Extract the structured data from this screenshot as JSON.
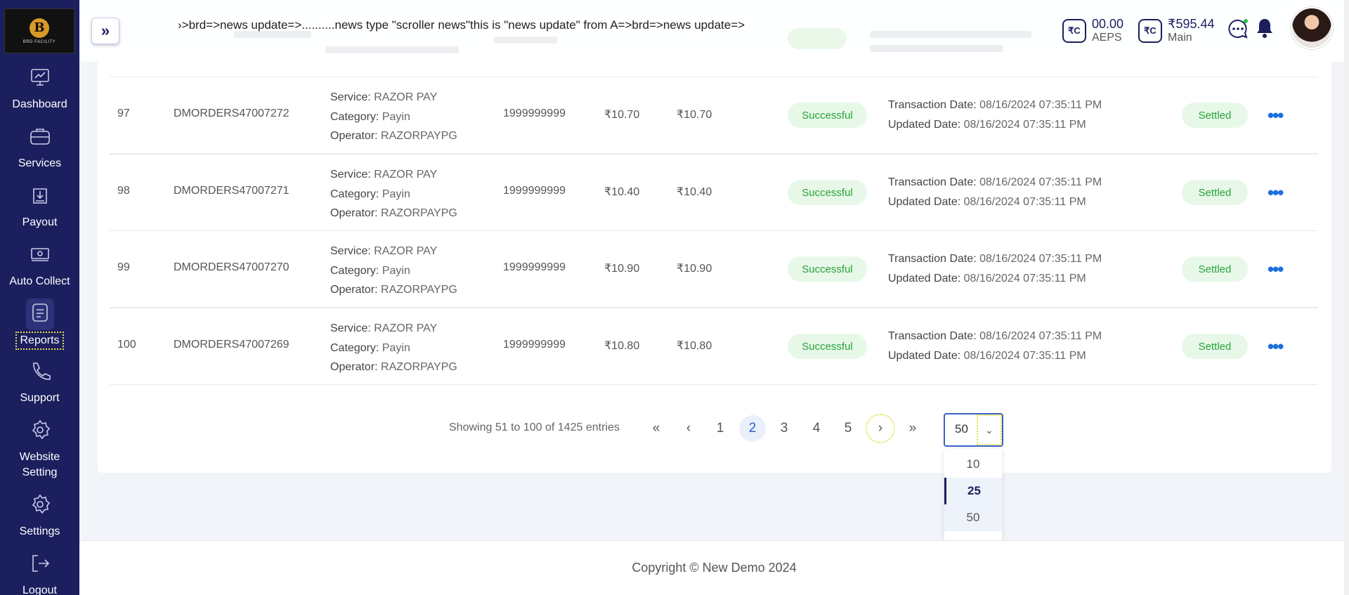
{
  "sidebar": {
    "logo_text": "BRD FACILITY",
    "items": [
      {
        "label": "Dashboard",
        "icon": "monitor-icon"
      },
      {
        "label": "Services",
        "icon": "briefcase-icon"
      },
      {
        "label": "Payout",
        "icon": "download-icon"
      },
      {
        "label": "Auto Collect",
        "icon": "cash-icon"
      },
      {
        "label": "Reports",
        "icon": "report-icon"
      },
      {
        "label": "Support",
        "icon": "phone-icon"
      },
      {
        "label": "Website Setting",
        "icon": "gear-icon"
      },
      {
        "label": "Settings",
        "icon": "gear-icon"
      },
      {
        "label": "Logout",
        "icon": "logout-icon"
      }
    ]
  },
  "header": {
    "toggle_glyph": "»",
    "news": "›>brd=>news update=>..........news type \"scroller news\"this is \"news update\" from A=>brd=>news update=>",
    "wallets": [
      {
        "amount": "00.00",
        "label": "AEPS",
        "icon_text": "₹C"
      },
      {
        "amount": "₹595.44",
        "label": "Main",
        "icon_text": "₹C"
      }
    ]
  },
  "rows": [
    {
      "num": "97",
      "order_id": "DMORDERS47007272",
      "service": "RAZOR PAY",
      "category": "Payin",
      "operator": "RAZORPAYPG",
      "mobile": "1999999999",
      "amount": "₹10.70",
      "net": "₹10.70",
      "status": "Successful",
      "txn_date": "08/16/2024 07:35:11 PM",
      "upd_date": "08/16/2024 07:35:11 PM",
      "settle": "Settled"
    },
    {
      "num": "98",
      "order_id": "DMORDERS47007271",
      "service": "RAZOR PAY",
      "category": "Payin",
      "operator": "RAZORPAYPG",
      "mobile": "1999999999",
      "amount": "₹10.40",
      "net": "₹10.40",
      "status": "Successful",
      "txn_date": "08/16/2024 07:35:11 PM",
      "upd_date": "08/16/2024 07:35:11 PM",
      "settle": "Settled"
    },
    {
      "num": "99",
      "order_id": "DMORDERS47007270",
      "service": "RAZOR PAY",
      "category": "Payin",
      "operator": "RAZORPAYPG",
      "mobile": "1999999999",
      "amount": "₹10.90",
      "net": "₹10.90",
      "status": "Successful",
      "txn_date": "08/16/2024 07:35:11 PM",
      "upd_date": "08/16/2024 07:35:11 PM",
      "settle": "Settled"
    },
    {
      "num": "100",
      "order_id": "DMORDERS47007269",
      "service": "RAZOR PAY",
      "category": "Payin",
      "operator": "RAZORPAYPG",
      "mobile": "1999999999",
      "amount": "₹10.80",
      "net": "₹10.80",
      "status": "Successful",
      "txn_date": "08/16/2024 07:35:11 PM",
      "upd_date": "08/16/2024 07:35:11 PM",
      "settle": "Settled"
    }
  ],
  "labels": {
    "service": "Service:",
    "category": "Category:",
    "operator": "Operator:",
    "txn_date": "Transaction Date:",
    "upd_date": "Updated Date:"
  },
  "pagination": {
    "showing": "Showing 51 to 100 of 1425 entries",
    "first": "«",
    "prev": "‹",
    "pages": [
      "1",
      "2",
      "3",
      "4",
      "5"
    ],
    "current": "2",
    "next": "›",
    "last": "»",
    "per_page": "50",
    "per_page_options": [
      "10",
      "25",
      "50"
    ]
  },
  "footer": {
    "copyright": "Copyright © New Demo 2024"
  }
}
